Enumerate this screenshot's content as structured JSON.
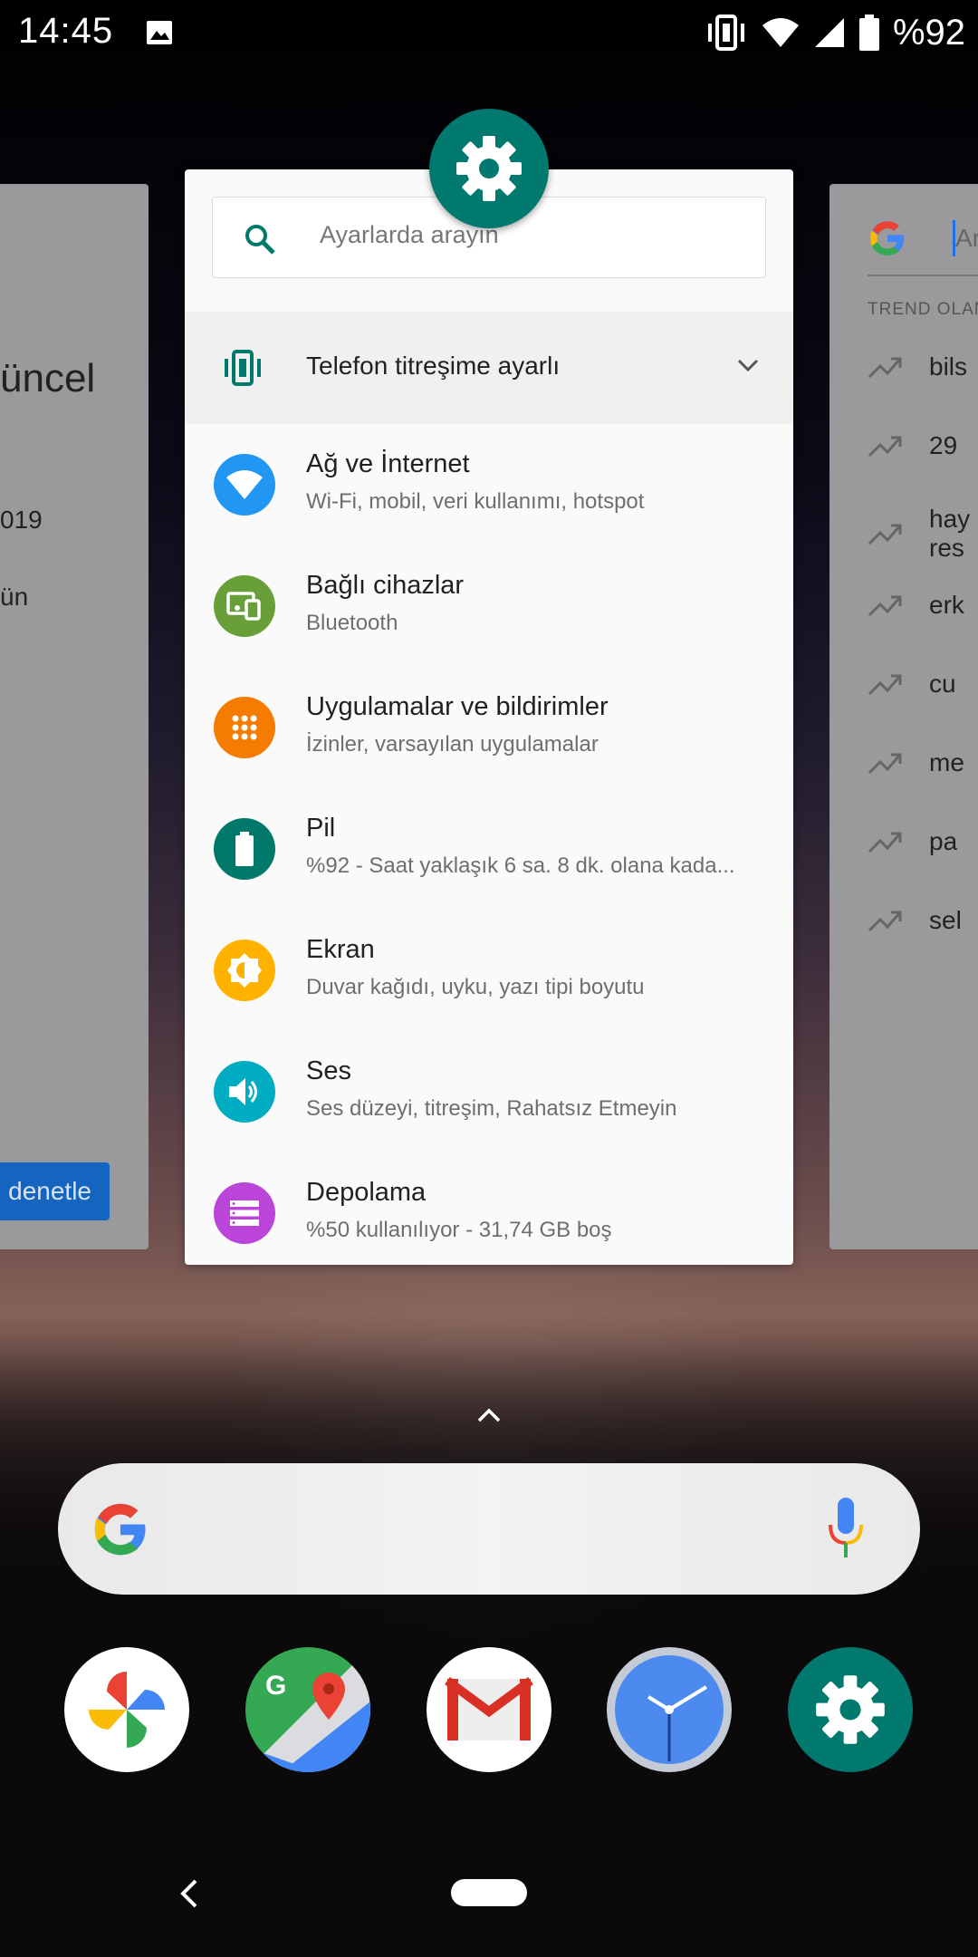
{
  "status_bar": {
    "time": "14:45",
    "battery": "%92",
    "icons": [
      "gallery-icon",
      "vibrate-icon",
      "wifi-icon",
      "signal-icon",
      "battery-icon"
    ]
  },
  "left_card": {
    "title_fragment": "üncel",
    "line1": "019",
    "line2": "ün",
    "button_label": "ri denetle"
  },
  "right_card": {
    "search_placeholder": "Ara",
    "trend_header": "TREND OLAN",
    "trends": [
      "bils",
      "29",
      "hay\nres",
      "erk",
      "cu",
      "me",
      "pa",
      "sel"
    ]
  },
  "settings": {
    "search_placeholder": "Ayarlarda arayın",
    "condition_label": "Telefon titreşime ayarlı",
    "items": [
      {
        "title": "Ağ ve İnternet",
        "subtitle": "Wi-Fi, mobil, veri kullanımı, hotspot",
        "color": "#2196f3",
        "icon": "wifi-icon"
      },
      {
        "title": "Bağlı cihazlar",
        "subtitle": "Bluetooth",
        "color": "#689f38",
        "icon": "devices-icon"
      },
      {
        "title": "Uygulamalar ve bildirimler",
        "subtitle": "İzinler, varsayılan uygulamalar",
        "color": "#f57c00",
        "icon": "apps-icon"
      },
      {
        "title": "Pil",
        "subtitle": "%92 - Saat yaklaşık 6 sa. 8 dk. olana kada...",
        "color": "#00796b",
        "icon": "battery-icon"
      },
      {
        "title": "Ekran",
        "subtitle": "Duvar kağıdı, uyku, yazı tipi boyutu",
        "color": "#ffb300",
        "icon": "brightness-icon"
      },
      {
        "title": "Ses",
        "subtitle": "Ses düzeyi, titreşim, Rahatsız Etmeyin",
        "color": "#00acc1",
        "icon": "volume-icon"
      },
      {
        "title": "Depolama",
        "subtitle": "%50 kullanılıyor - 31,74 GB boş",
        "color": "#ba45d8",
        "icon": "storage-icon"
      }
    ]
  },
  "dock": [
    "photos-icon",
    "maps-icon",
    "gmail-icon",
    "clock-icon",
    "settings-icon"
  ]
}
